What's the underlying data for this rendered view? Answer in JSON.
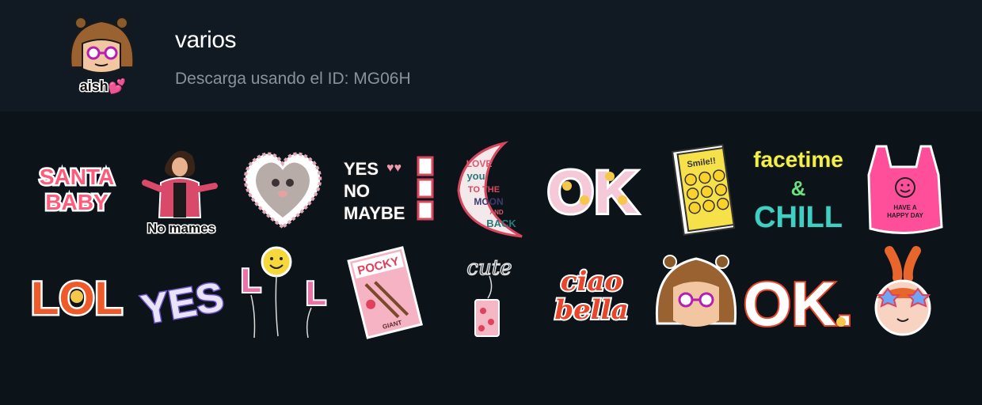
{
  "header": {
    "avatar_caption": "aish💕",
    "title": "varios",
    "subtitle": "Descarga usando el ID: MG06H"
  },
  "stickers": [
    {
      "name": "santa-baby",
      "text_line1": "SANTA",
      "text_line2": "BABY"
    },
    {
      "name": "no-mames",
      "caption": "No mames"
    },
    {
      "name": "heart-cat-frame"
    },
    {
      "name": "yes-no-maybe",
      "line1": "YES",
      "line2": "NO",
      "line3": "MAYBE"
    },
    {
      "name": "love-you-moon",
      "line1": "LOVE",
      "line2": "you",
      "line3": "TO THE",
      "line4": "MOON",
      "line5": "AND",
      "line6": "BACK"
    },
    {
      "name": "ok-flowers",
      "text": "OK"
    },
    {
      "name": "smile-stickers-sheet",
      "label": "Smile!!"
    },
    {
      "name": "facetime-and-chill",
      "line1": "facetime",
      "line2": "&",
      "line3": "CHILL"
    },
    {
      "name": "have-a-happy-day-bag",
      "line1": "HAVE A",
      "line2": "HAPPY DAY"
    },
    {
      "name": "lol-flower",
      "text": "LOL"
    },
    {
      "name": "yes-3d",
      "text": "YES"
    },
    {
      "name": "lol-balloons",
      "left": "L",
      "right": "L"
    },
    {
      "name": "pocky-box",
      "label": "POCKY",
      "sub": "GIANT"
    },
    {
      "name": "cute-can",
      "text": "cute"
    },
    {
      "name": "ciao-bella",
      "line1": "ciao",
      "line2": "bella"
    },
    {
      "name": "girl-glasses"
    },
    {
      "name": "rainbow-ok",
      "text": "OK."
    },
    {
      "name": "blossom-glasses"
    }
  ]
}
